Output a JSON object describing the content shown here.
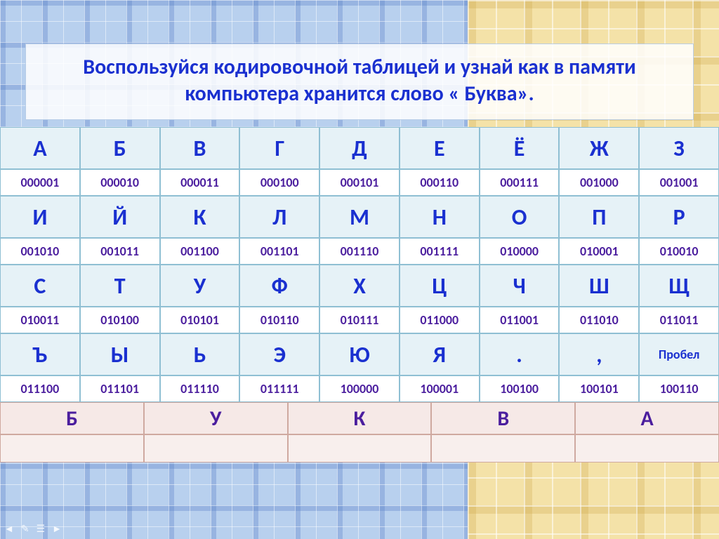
{
  "title": "Воспользуйся кодировочной таблицей  и узнай как в памяти компьютера хранится слово « Буква».",
  "encoding_rows": [
    {
      "letters": [
        "А",
        "Б",
        "В",
        "Г",
        "Д",
        "Е",
        "Ё",
        "Ж",
        "З"
      ],
      "codes": [
        "000001",
        "000010",
        "000011",
        "000100",
        "000101",
        "000110",
        "000111",
        "001000",
        "001001"
      ]
    },
    {
      "letters": [
        "И",
        "Й",
        "К",
        "Л",
        "М",
        "Н",
        "О",
        "П",
        "Р"
      ],
      "codes": [
        "001010",
        "001011",
        "001100",
        "001101",
        "001110",
        "001111",
        "010000",
        "010001",
        "010010"
      ]
    },
    {
      "letters": [
        "С",
        "Т",
        "У",
        "Ф",
        "Х",
        "Ц",
        "Ч",
        "Ш",
        "Щ"
      ],
      "codes": [
        "010011",
        "010100",
        "010101",
        "010110",
        "010111",
        "011000",
        "011001",
        "011010",
        "011011"
      ]
    },
    {
      "letters": [
        "Ъ",
        "Ы",
        "Ь",
        "Э",
        "Ю",
        "Я",
        ".",
        ",",
        "Пробел"
      ],
      "codes": [
        "011100",
        "011101",
        "011110",
        "011111",
        "100000",
        "100001",
        "100100",
        "100101",
        "100110"
      ]
    }
  ],
  "answer_letters": [
    "Б",
    "У",
    "К",
    "В",
    "А"
  ],
  "answer_codes": [
    "",
    "",
    "",
    "",
    ""
  ],
  "nav": {
    "prev": "◄",
    "pen": "✎",
    "menu": "☰",
    "next": "►"
  }
}
